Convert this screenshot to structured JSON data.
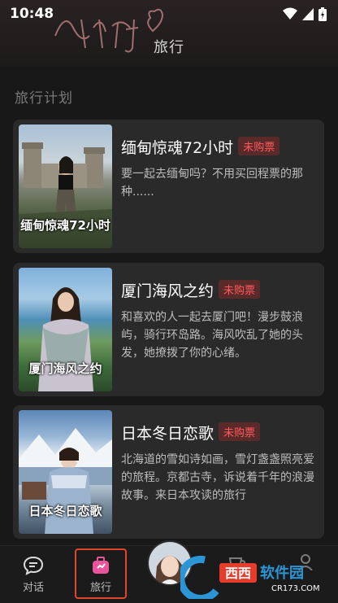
{
  "status": {
    "time": "10:48"
  },
  "header": {
    "title": "旅行"
  },
  "section": {
    "title": "旅行计划"
  },
  "cards": [
    {
      "title": "缅甸惊魂72小时",
      "badge": "未购票",
      "desc": "要一起去缅甸吗？不用买回程票的那种......",
      "caption": "缅甸惊魂72小时"
    },
    {
      "title": "厦门海风之约",
      "badge": "未购票",
      "desc": "和喜欢的人一起去厦门吧！漫步鼓浪屿，骑行环岛路。海风吹乱了她的头发，她撩拨了你的心绪。",
      "caption": "厦门海风之约"
    },
    {
      "title": "日本冬日恋歌",
      "badge": "未购票",
      "desc": "北海道的雪如诗如画，雪灯盏盏照亮爱的旅程。京都古寺，诉说着千年的浪漫故事。来日本攻读的旅行",
      "caption": "日本冬日恋歌"
    }
  ],
  "tabs": {
    "chat": "对话",
    "travel": "旅行"
  },
  "colors": {
    "badge_text": "#ff5b5b",
    "badge_bg": "#5a2a2a",
    "active_border": "#e0472a",
    "travel_icon": "#e8559b"
  }
}
